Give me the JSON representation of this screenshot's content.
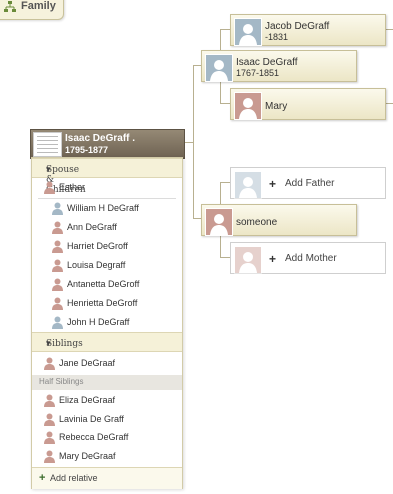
{
  "tab": {
    "label": "Family",
    "icon": "tree-icon"
  },
  "focus_person": {
    "name": "Isaac DeGraff .",
    "dates": "1795-1877",
    "icon": "document-thumbnail-icon"
  },
  "tree": {
    "father": {
      "name": "Isaac DeGraff",
      "dates": "1767-1851",
      "gender": "male"
    },
    "grandfather": {
      "name": "Jacob DeGraff",
      "dates": "-1831",
      "gender": "male"
    },
    "grandmother": {
      "name": "Mary",
      "gender": "female"
    },
    "add_father_label": "Add Father",
    "spouse_parent": {
      "name": "someone",
      "gender": "female"
    },
    "add_mother_label": "Add Mother"
  },
  "panel": {
    "spouse_children_label": "Spouse & Children",
    "spouse": {
      "name": "Esther",
      "gender": "female"
    },
    "children": [
      {
        "name": "William H DeGraff",
        "gender": "male"
      },
      {
        "name": "Ann DeGraff",
        "gender": "female"
      },
      {
        "name": "Harriet DeGroff",
        "gender": "female"
      },
      {
        "name": "Louisa Degraff",
        "gender": "female"
      },
      {
        "name": "Antanetta DeGroff",
        "gender": "female"
      },
      {
        "name": "Henrietta DeGroff",
        "gender": "female"
      },
      {
        "name": "John H DeGraff",
        "gender": "male"
      }
    ],
    "siblings_label": "Siblings",
    "siblings": [
      {
        "name": "Jane DeGraaf",
        "gender": "female"
      }
    ],
    "half_siblings_label": "Half Siblings",
    "half_siblings": [
      {
        "name": "Eliza DeGraaf",
        "gender": "female"
      },
      {
        "name": "Lavinia De Graff",
        "gender": "female"
      },
      {
        "name": "Rebecca DeGraff",
        "gender": "female"
      },
      {
        "name": "Mary DeGraaf",
        "gender": "female"
      }
    ],
    "add_relative_label": "Add relative"
  },
  "colors": {
    "male": "#a4b8c6",
    "female": "#c99a91",
    "focus": "#7f7361",
    "card": "#f3efd6"
  }
}
